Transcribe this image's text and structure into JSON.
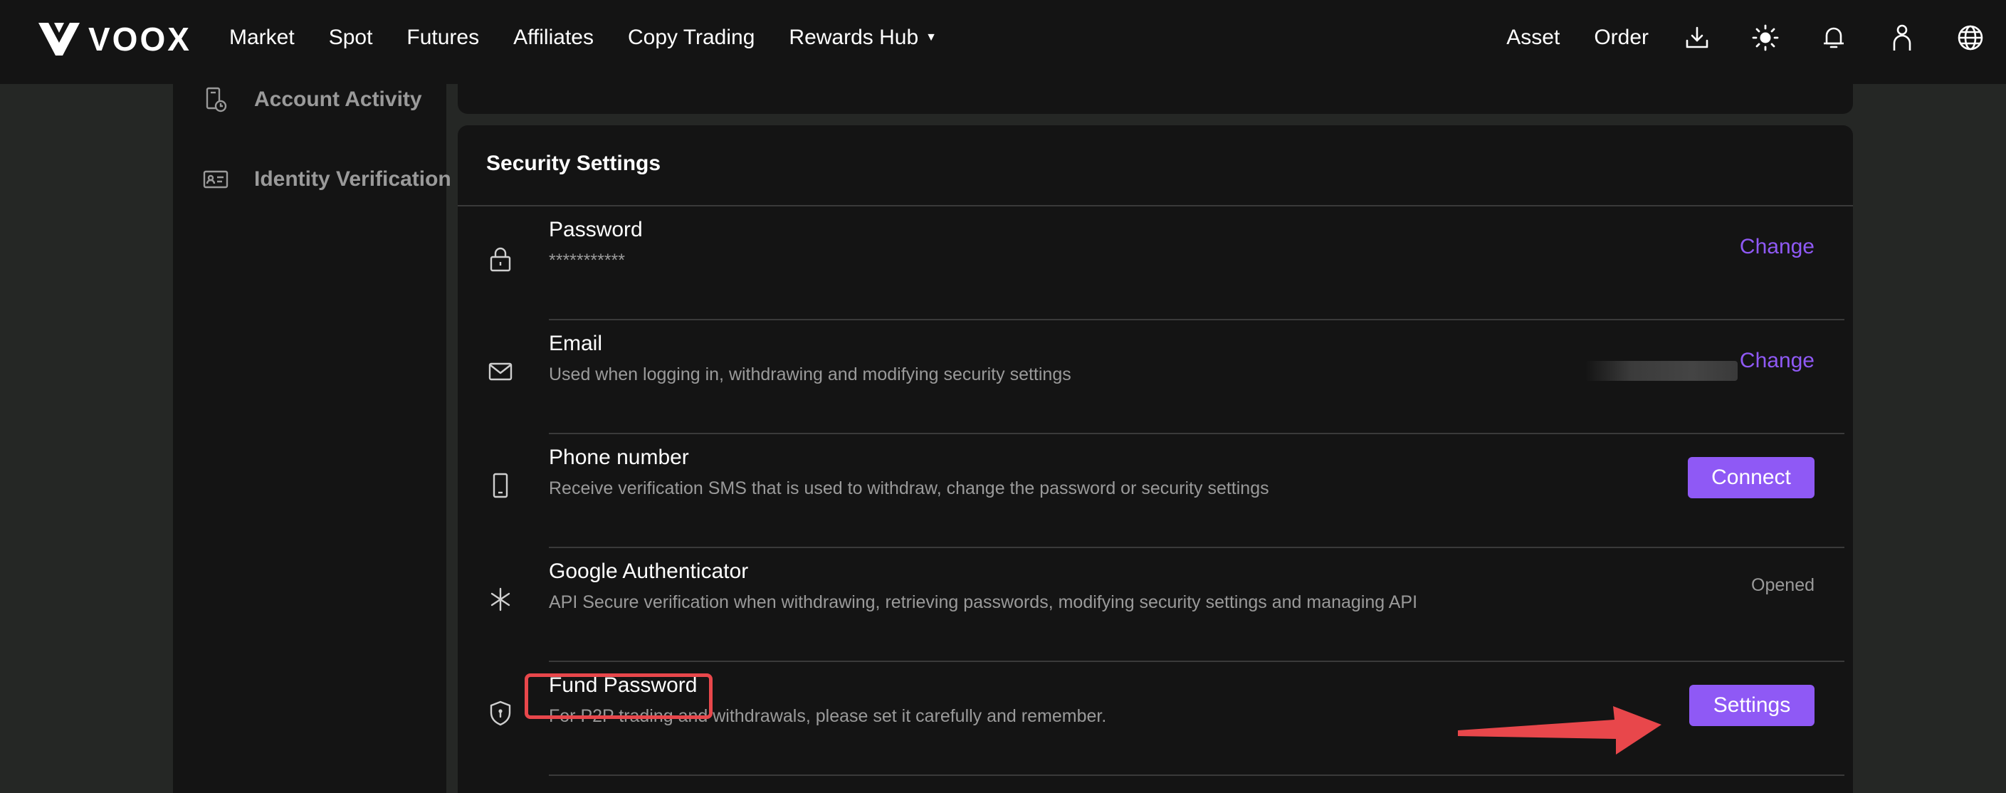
{
  "brand": {
    "name": "VOOX"
  },
  "nav": {
    "items": [
      {
        "label": "Market"
      },
      {
        "label": "Spot"
      },
      {
        "label": "Futures"
      },
      {
        "label": "Affiliates"
      },
      {
        "label": "Copy Trading"
      },
      {
        "label": "Rewards Hub"
      }
    ],
    "right_items": [
      {
        "label": "Asset"
      },
      {
        "label": "Order"
      }
    ],
    "icons": [
      "download-icon",
      "theme-sun-icon",
      "bell-icon",
      "user-icon",
      "globe-icon"
    ]
  },
  "sidebar": {
    "items": [
      {
        "label": "Account Activity",
        "icon": "account-activity-icon"
      },
      {
        "label": "Identity Verification",
        "icon": "id-card-icon"
      }
    ]
  },
  "security": {
    "title": "Security Settings",
    "rows": [
      {
        "title": "Password",
        "desc": "***********",
        "action_type": "link",
        "action": "Change",
        "icon": "lock-icon"
      },
      {
        "title": "Email",
        "desc": "Used when logging in, withdrawing and modifying security settings",
        "action_type": "link",
        "action": "Change",
        "icon": "mail-icon"
      },
      {
        "title": "Phone number",
        "desc": "Receive verification SMS that is used to withdraw, change the password or security settings",
        "action_type": "button",
        "action": "Connect",
        "icon": "phone-icon"
      },
      {
        "title": "Google Authenticator",
        "desc": "API Secure verification when withdrawing, retrieving passwords, modifying security settings and managing API",
        "action_type": "status",
        "action": "Opened",
        "icon": "authenticator-asterisk-icon"
      },
      {
        "title": "Fund Password",
        "desc": "For P2P trading and withdrawals, please set it carefully and remember.",
        "action_type": "button",
        "action": "Settings",
        "icon": "shield-icon"
      }
    ]
  },
  "colors": {
    "accent": "#8f59f5",
    "annotation": "#e8474b",
    "background": "#252725",
    "panel": "#141414"
  }
}
